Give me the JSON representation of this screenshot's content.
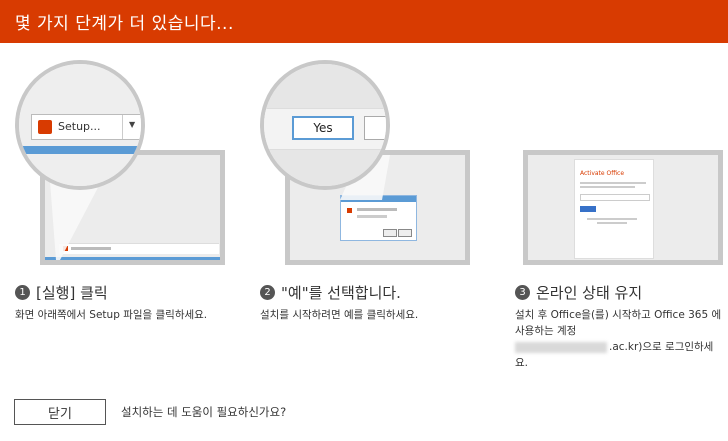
{
  "header": {
    "title": "몇 가지 단계가 더 있습니다..."
  },
  "steps": [
    {
      "number": "1",
      "label": "[실행] 클릭",
      "description": "화면 아래쪽에서 Setup 파일을 클릭하세요.",
      "mock": {
        "button_text": "Setup..."
      }
    },
    {
      "number": "2",
      "label": "\"예\"를 선택합니다.",
      "description": "설치를 시작하려면 예를 클릭하세요.",
      "mock": {
        "yes_button": "Yes"
      }
    },
    {
      "number": "3",
      "label": "온라인 상태 유지",
      "description_line1": "설치 후 Office을(를) 시작하고 Office 365 에 사용하는 계정",
      "description_blurred_suffix": ".ac.kr)으로 로그인하세요.",
      "mock": {
        "dialog_title": "Activate Office"
      }
    }
  ],
  "footer": {
    "close_label": "닫기",
    "help_text": "설치하는 데 도움이 필요하신가요?"
  },
  "colors": {
    "header_bg": "#d83b01",
    "office_orange": "#d83b01",
    "accent_blue": "#5b9bd5"
  }
}
